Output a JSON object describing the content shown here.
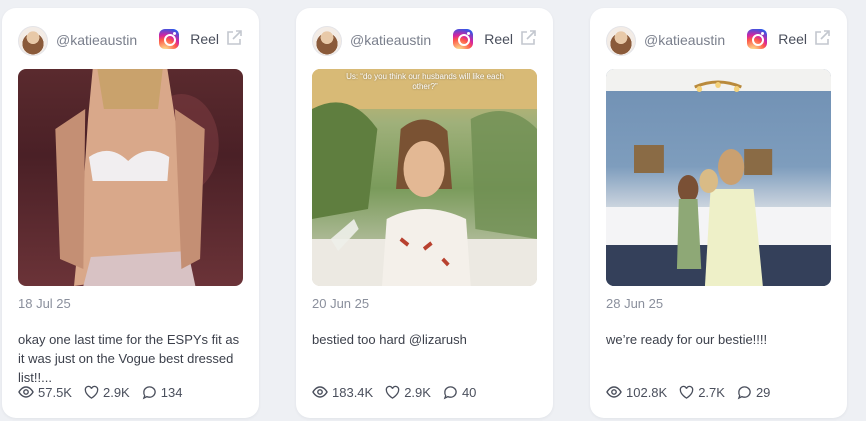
{
  "posts": [
    {
      "handle": "@katieaustin",
      "type": "Reel",
      "date": "18 Jul 25",
      "caption": "okay one last time for the ESPYs fit as it was just on the Vogue best dressed list!!...",
      "views": "57.5K",
      "likes": "2.9K",
      "comments": "134",
      "platform_icon": "instagram-icon"
    },
    {
      "handle": "@katieaustin",
      "type": "Reel",
      "date": "20 Jun 25",
      "caption": "bestied too hard @lizarush",
      "views": "183.4K",
      "likes": "2.9K",
      "comments": "40",
      "overlay_text": "Us: “do you think our husbands will like each other?”",
      "platform_icon": "instagram-icon"
    },
    {
      "handle": "@katieaustin",
      "type": "Reel",
      "date": "28 Jun 25",
      "caption": "we’re ready for our bestie!!!!",
      "views": "102.8K",
      "likes": "2.7K",
      "comments": "29",
      "platform_icon": "instagram-icon"
    }
  ],
  "colors": {
    "card_bg": "#ffffff",
    "page_bg": "#eef0f4",
    "muted_text": "#8a8f9c"
  }
}
